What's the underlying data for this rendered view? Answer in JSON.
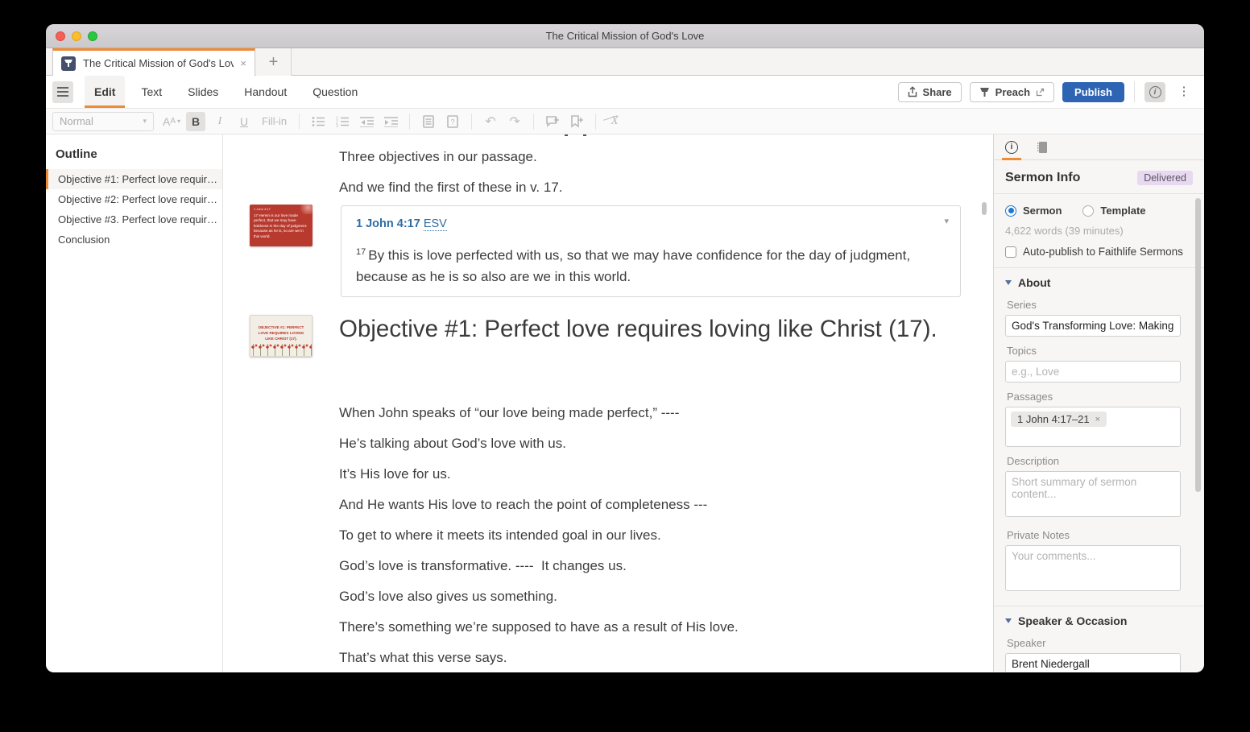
{
  "window": {
    "title": "The Critical Mission of God's Love",
    "tab": {
      "title": "The Critical Mission of God's Love",
      "close": "×",
      "new_tab": "+"
    },
    "menu": {
      "items": [
        {
          "label": "Edit",
          "active": true
        },
        {
          "label": "Text",
          "active": false
        },
        {
          "label": "Slides",
          "active": false
        },
        {
          "label": "Handout",
          "active": false
        },
        {
          "label": "Question",
          "active": false
        }
      ]
    },
    "actions": {
      "share": "Share",
      "preach": "Preach",
      "publish": "Publish"
    }
  },
  "toolbar": {
    "style": "Normal",
    "font_size": "A",
    "bold": "B",
    "italic": "I",
    "underline": "U",
    "fill_in": "Fill-in",
    "question": "?",
    "undo": "↶",
    "redo": "↷",
    "clear_format": "X"
  },
  "outline": {
    "title": "Outline",
    "items": [
      {
        "label": "Objective #1: Perfect love requir…",
        "active": true
      },
      {
        "label": "Objective #2: Perfect love requir…",
        "active": false
      },
      {
        "label": "Objective #3. Perfect love requir…",
        "active": false
      },
      {
        "label": "Conclusion",
        "active": false
      }
    ]
  },
  "editor": {
    "intro": [
      "Three objectives in our passage.",
      "And we find the first of these in v. 17."
    ],
    "verse_card": {
      "reference": "1 John 4:17",
      "version": "ESV",
      "number": "17",
      "text": "By this is love perfected with us, so that we may have confidence for the day of judgment, because as he is so also are we in this world.",
      "collapse_chevron": "▾"
    },
    "slide_verse": {
      "title": "1 John 4:17",
      "body": "17 Herein is our love made perfect, that we may have boldness in the day of judgment: because as he is, so are we in this world."
    },
    "slide_heading": {
      "body": "OBJECTIVE #1: PERFECT LOVE REQUIRES LOVING LIKE CHRIST (17)."
    },
    "heading": "Objective #1: Perfect love requires loving like Christ (17).",
    "paragraphs": [
      "When John speaks of “our love being made perfect,” ----",
      "He’s talking about God’s love with us.",
      "It’s His love for us.",
      "And He wants His love to reach the point of completeness ---",
      "To get to where it meets its intended goal in our lives.",
      "God’s love is transformative. ----  It changes us.",
      "God’s love also gives us something.",
      "There’s something we’re supposed to have as a result of His love.",
      "That’s what this verse says."
    ]
  },
  "sermon_info": {
    "title": "Sermon Info",
    "status": "Delivered",
    "type": {
      "sermon": "Sermon",
      "template": "Template",
      "selected": "Sermon"
    },
    "word_count": "4,622 words (39 minutes)",
    "auto_publish": "Auto-publish to Faithlife Sermons",
    "about": {
      "title": "About",
      "series_label": "Series",
      "series_value": "God's Transforming Love: Making the",
      "topics_label": "Topics",
      "topics_placeholder": "e.g., Love",
      "passages_label": "Passages",
      "passage": "1 John 4:17–21",
      "remove": "×",
      "description_label": "Description",
      "description_placeholder": "Short summary of sermon content...",
      "notes_label": "Private Notes",
      "notes_placeholder": "Your comments..."
    },
    "speaker_occasion": {
      "title": "Speaker & Occasion",
      "speaker_label": "Speaker",
      "speaker_value": "Brent Niedergall"
    }
  },
  "colors": {
    "accent_orange": "#ee8b35",
    "publish_blue": "#2d64b3",
    "link_blue": "#2e6da4",
    "radio_blue": "#2176d2",
    "badge_bg": "#e7d9ef",
    "slide_red": "#b83a2f"
  }
}
